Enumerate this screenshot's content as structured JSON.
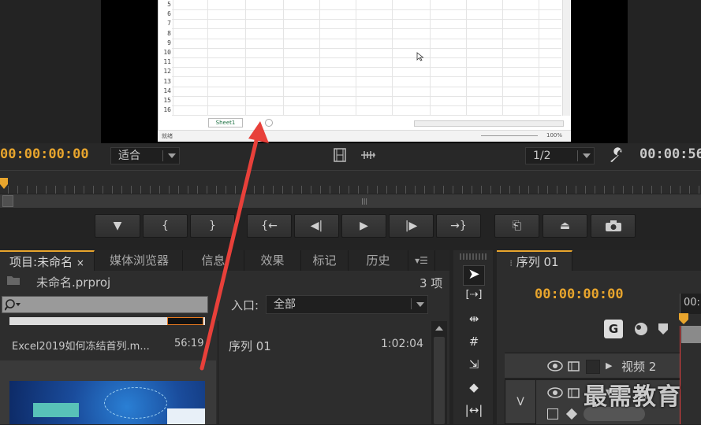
{
  "monitor": {
    "excel": {
      "row_numbers": [
        "5",
        "6",
        "7",
        "8",
        "9",
        "10",
        "11",
        "12",
        "13",
        "14",
        "15",
        "16"
      ],
      "sheet_tab": "Sheet1",
      "status_left": "就绪",
      "zoom": "100%"
    },
    "timecode_left": "00:00:00:00",
    "timecode_right": "00:00:56",
    "fit_dropdown": "适合",
    "resolution_dropdown": "1/2"
  },
  "project_panel": {
    "tabs": [
      "项目:未命名",
      "媒体浏览器",
      "信息",
      "效果",
      "标记",
      "历史"
    ],
    "project_file": "未命名.prproj",
    "item_count": "3 项",
    "search_placeholder": "",
    "entry_label": "入口:",
    "entry_dropdown": "全部",
    "items": [
      {
        "name": "Excel2019如何冻结首列.m...",
        "duration": "56:19"
      },
      {
        "name": "序列 01",
        "duration": "1:02:04"
      }
    ]
  },
  "sequence_panel": {
    "tab": "序列 01",
    "timecode": "00:00:00:00",
    "ruler_label": "00:",
    "tracks": [
      {
        "label": "视频 2"
      },
      {
        "label": "视"
      }
    ],
    "v_marker": "V"
  },
  "watermark": "最需教育",
  "colors": {
    "timecode_accent": "#e8a52d",
    "arrow": "#e8403a",
    "panel_bg": "#2d2d2d"
  }
}
